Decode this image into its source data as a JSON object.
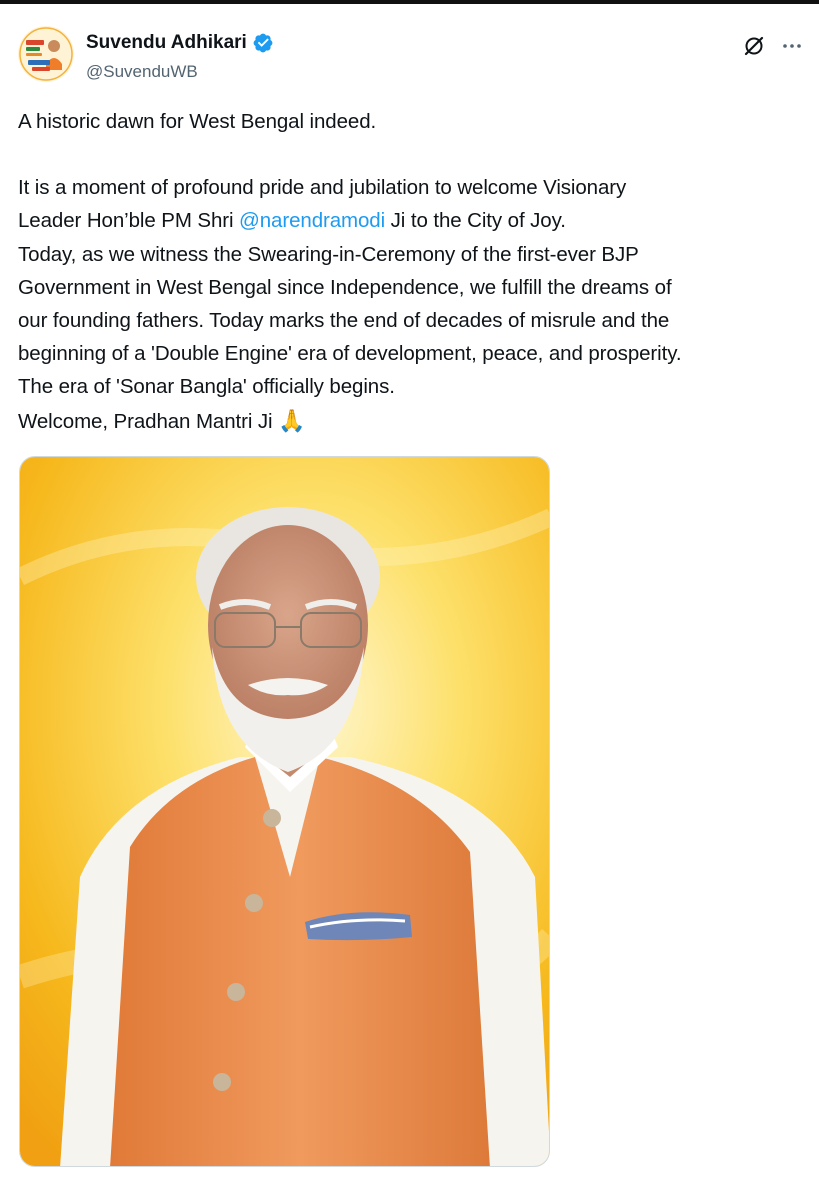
{
  "tweet": {
    "author": {
      "display_name": "Suvendu Adhikari",
      "handle": "@SuvenduWB",
      "verified": true,
      "avatar_icon": "avatar-image"
    },
    "actions": {
      "grok_icon": "grok-icon",
      "more_icon": "more-options-icon"
    },
    "text": {
      "line1": "A historic dawn for West Bengal indeed.",
      "line2": "It is a moment of profound pride and jubilation to welcome Visionary",
      "line3_before": "Leader Hon’ble PM Shri ",
      "mention": "@narendramodi",
      "line3_after": " Ji to the City of Joy.",
      "line4": "Today, as we witness the Swearing-in-Ceremony of the first-ever BJP",
      "line5": "Government in West Bengal since Independence, we fulfill the dreams of",
      "line6": "our founding fathers. Today marks the end of decades of misrule and the",
      "line7": "beginning of a 'Double Engine' era of development, peace, and prosperity.",
      "line8": "The era of 'Sonar Bangla' officially begins.",
      "line9": "Welcome, Pradhan Mantri Ji",
      "line9_emoji": "🙏"
    },
    "media": {
      "type": "photo"
    }
  },
  "colors": {
    "text": "#0f1419",
    "secondary": "#536471",
    "link": "#1d9bf0",
    "verified": "#1d9bf0",
    "photo_bg": "#f7c21c",
    "vest": "#e8894a"
  }
}
